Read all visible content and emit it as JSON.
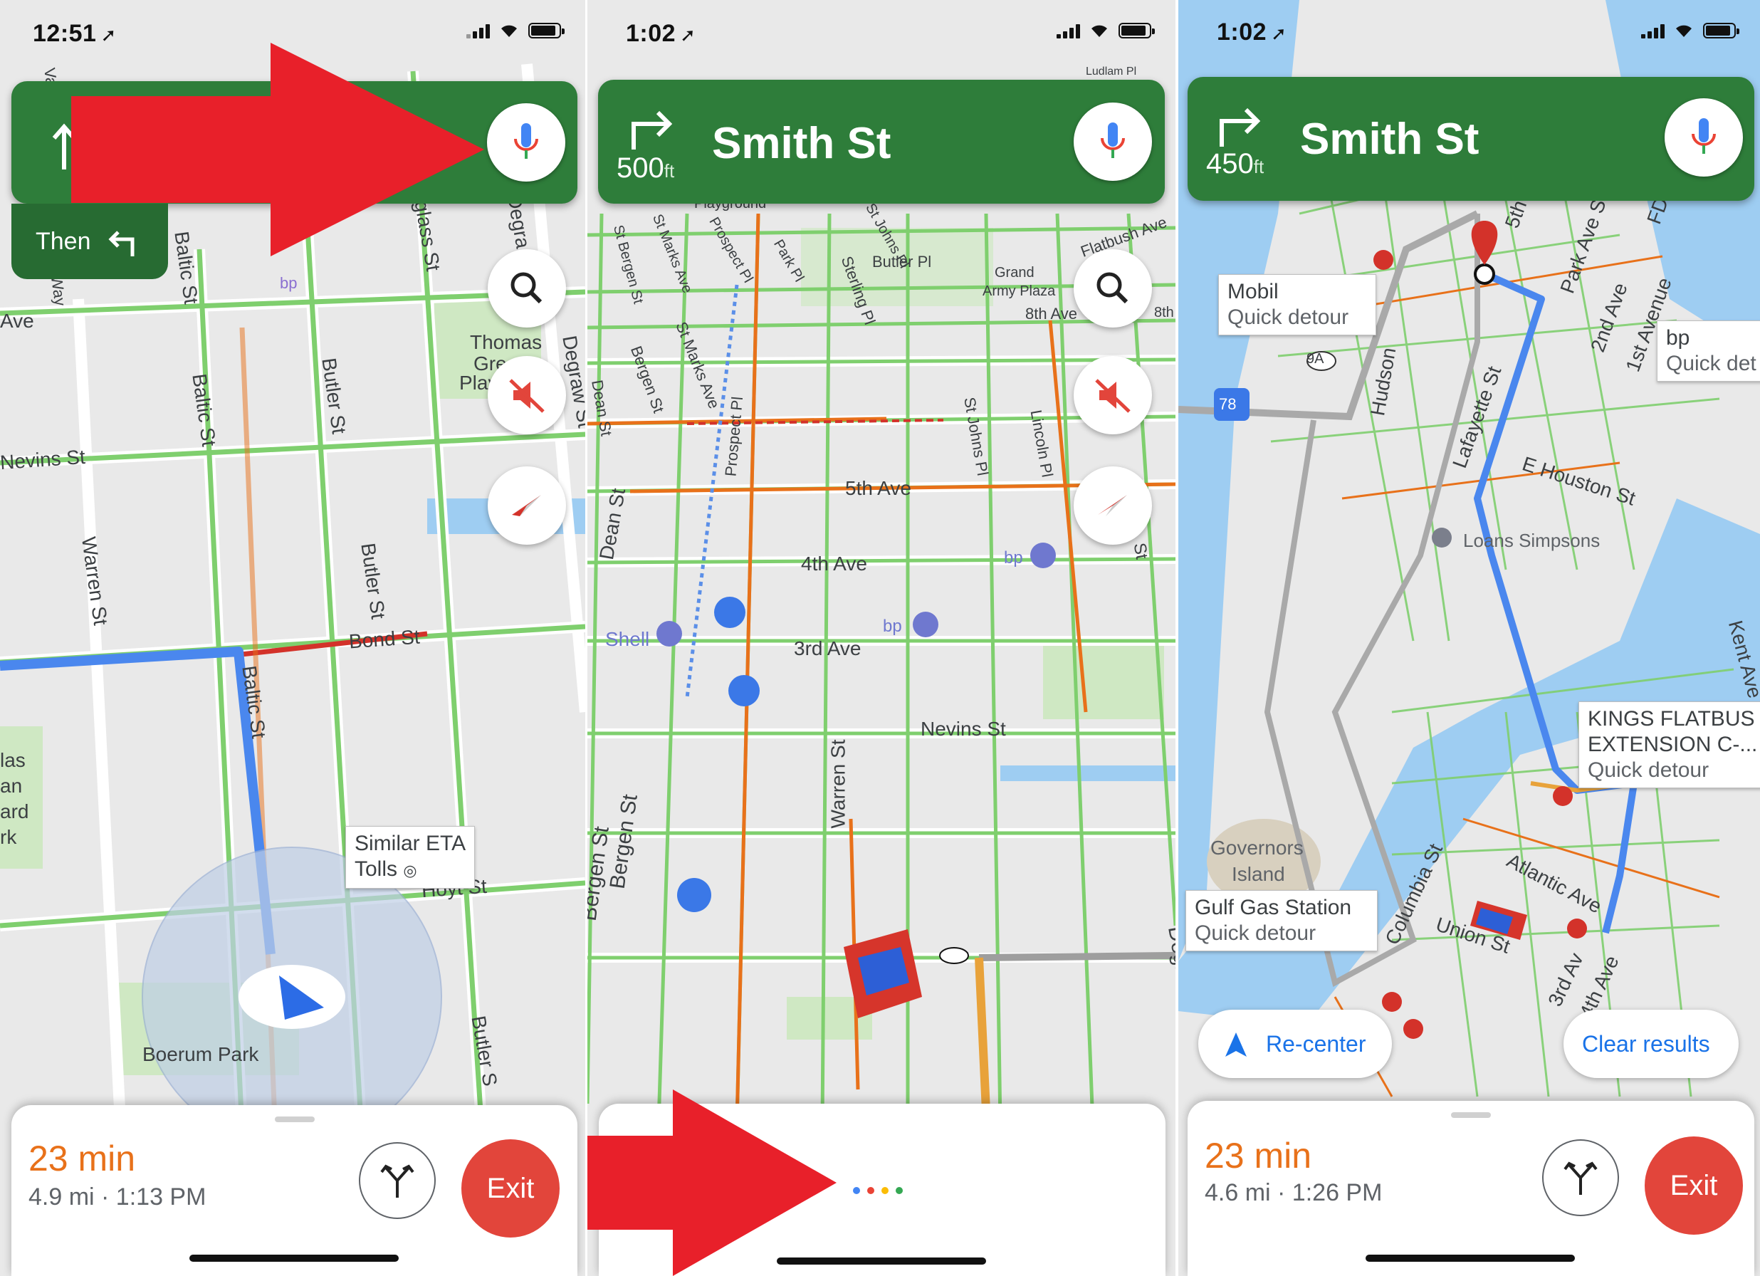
{
  "colors": {
    "nav_green": "#2e7d3a",
    "route_blue": "#4285f4",
    "eta_orange": "#e8711a",
    "exit_red": "#e2453b",
    "annotation_red": "#e8202a"
  },
  "screen1": {
    "time": "12:51",
    "then_label": "Then",
    "map_labels": {
      "douglass": "Douglass St",
      "degraw_top": "Degra",
      "baltic_top": "Baltic St",
      "butler1": "Butler St",
      "baltic2": "Baltic St",
      "thomas1": "Thomas",
      "thomas2": "Green",
      "thomas3": "Play",
      "degraw_side": "Degraw St",
      "nevins": "Nevins St",
      "ave": "Ave",
      "warren": "Warren St",
      "butler2": "Butler St",
      "bond": "Bond St",
      "baltic3": "Baltic St",
      "hoyt": "Hoyt St",
      "boerum": "Boerum Park",
      "butler3": "Butler S",
      "left1": "las",
      "left2": "an",
      "left3": "ard",
      "left4": "rk",
      "bp": "bp",
      "way": "Way",
      "va": "Va"
    },
    "callout_line1": "Similar ETA",
    "callout_line2": "Tolls",
    "eta": "23 min",
    "eta_sub": "4.9 mi · 1:13 PM",
    "exit_label": "Exit"
  },
  "screen2": {
    "time": "1:02",
    "street": "Smith St",
    "distance": "500",
    "unit": "ft",
    "map_labels": {
      "playground": "Playground",
      "flatbush": "Flatbush Ave",
      "butler": "Butler Pl",
      "grand1": "Grand",
      "grand2": "Army Plaza",
      "eighth": "8th Ave",
      "stjohns": "St Johns Pl",
      "sterling": "Sterling Pl",
      "park": "Park Pl",
      "prospect1": "Prospect Pl",
      "stmarks1": "St Marks Ave",
      "bergen_top": "St Bergen St",
      "stmarks2": "St Marks Ave",
      "bergen2": "Bergen St",
      "dean1": "Dean St",
      "prospect2": "Prospect Pl",
      "stjohns2": "St Johns Pl",
      "lincoln": "Lincoln Pl",
      "fifth": "5th Ave",
      "dean2": "Dean St",
      "fourth": "4th Ave",
      "bp1": "bp",
      "bp2": "bp",
      "shell": "Shell",
      "third": "3rd Ave",
      "nevins": "Nevins St",
      "warren": "Warren St",
      "bergen3": "Bergen St",
      "bergen4": "Bergen St",
      "degraw": "Degraw",
      "st": "St",
      "ludlam": "Ludlam Pl",
      "eighth2": "8th"
    }
  },
  "screen3": {
    "time": "1:02",
    "street": "Smith St",
    "distance": "450",
    "unit": "ft",
    "callouts": {
      "mobil_name": "Mobil",
      "mobil_sub": "Quick detour",
      "bp_name": "bp",
      "bp_sub": "Quick det",
      "kings1": "KINGS FLATBUS",
      "kings2": "EXTENSION C-...",
      "kings_sub": "Quick detour",
      "gulf_name": "Gulf Gas Station",
      "gulf_sub": "Quick detour"
    },
    "map_labels": {
      "fifth": "5th",
      "parkave": "Park Ave S",
      "fdr": "FD",
      "secondave": "2nd Ave",
      "firstave": "1st Avenue",
      "ninea": "9A",
      "hudson": "Hudson",
      "seventyeight": "78",
      "lafayette": "Lafayette St",
      "houston": "E Houston St",
      "loans": "Loans Simpsons",
      "kent": "Kent Ave",
      "governors1": "Governors",
      "governors2": "Island",
      "columbia": "Columbia St",
      "union": "Union St",
      "atlantic": "Atlantic Ave",
      "thirdave": "3rd Av",
      "fourthave": "4th Ave"
    },
    "recenter": "Re-center",
    "clear_results": "Clear results",
    "eta": "23 min",
    "eta_sub": "4.6 mi · 1:26 PM",
    "exit_label": "Exit"
  }
}
